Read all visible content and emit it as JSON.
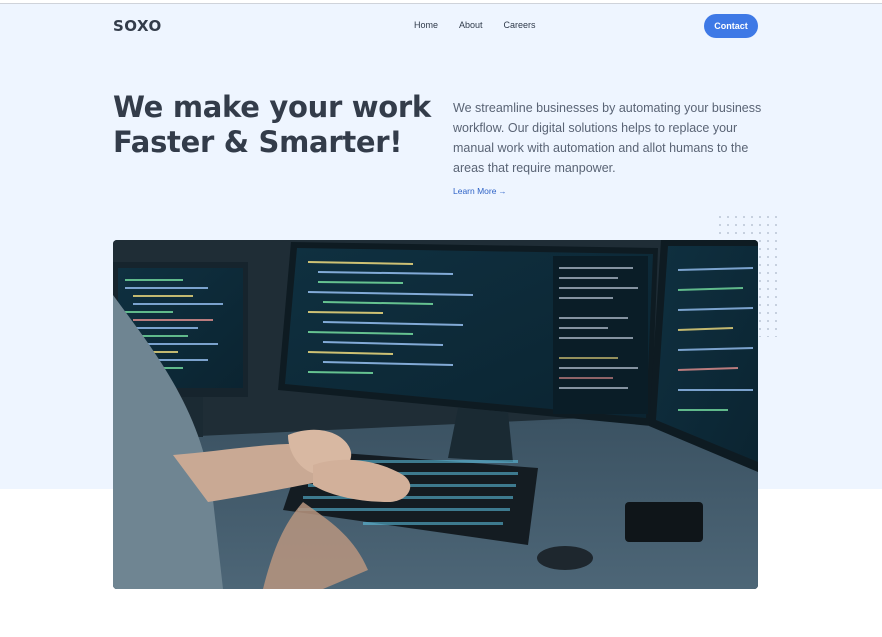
{
  "nav": {
    "logo": "SOXO",
    "items": [
      {
        "label": "Home"
      },
      {
        "label": "About"
      },
      {
        "label": "Careers"
      }
    ],
    "contact_label": "Contact"
  },
  "hero": {
    "headline_line1": "We make your work",
    "headline_line2": "Faster & Smarter!",
    "description": "We streamline businesses by automating your business workflow. Our digital solutions helps to replace your manual work with automation and allot humans to the areas that require manpower.",
    "learn_more_label": "Learn More",
    "learn_more_arrow": "→"
  },
  "icons": {
    "learn_more": "arrow-right-icon"
  },
  "colors": {
    "accent": "#3e79e6",
    "hero_background": "#eef5ff",
    "heading": "#333c4a",
    "body_text": "#5a6475",
    "link": "#2f63c7"
  }
}
